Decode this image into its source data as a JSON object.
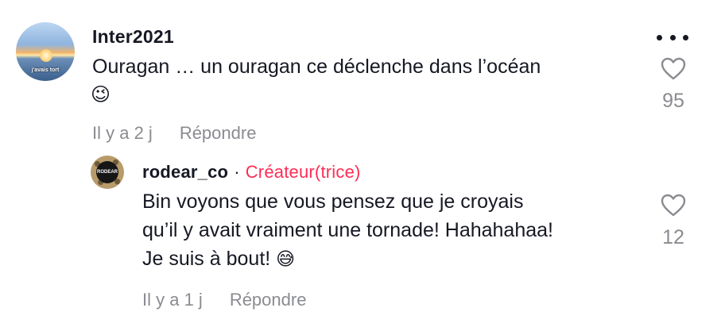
{
  "comment": {
    "username": "Inter2021",
    "avatar_caption_top": "",
    "avatar_caption": "j'avais tort",
    "text_line1": "Ouragan … un ouragan ce déclenche dans l’océan",
    "emoji": "😉",
    "time": "Il y a 2 j",
    "reply_label": "Répondre",
    "like_count": "95",
    "more_icon": "more-dots-icon",
    "like_icon": "heart-outline-icon"
  },
  "reply": {
    "username": "rodear_co",
    "separator": "·",
    "badge": "Créateur(trice)",
    "avatar_text": "RODEAR",
    "text_line1": "Bin voyons que vous pensez que je croyais",
    "text_line2": "qu’il y avait vraiment une tornade! Hahahahaa!",
    "text_line3": "Je suis à bout!",
    "emoji": "😅",
    "time": "Il y a 1 j",
    "reply_label": "Répondre",
    "like_count": "12",
    "like_icon": "heart-outline-icon"
  },
  "colors": {
    "text": "#161823",
    "muted": "#8a8b91",
    "creator": "#fe2c55"
  }
}
